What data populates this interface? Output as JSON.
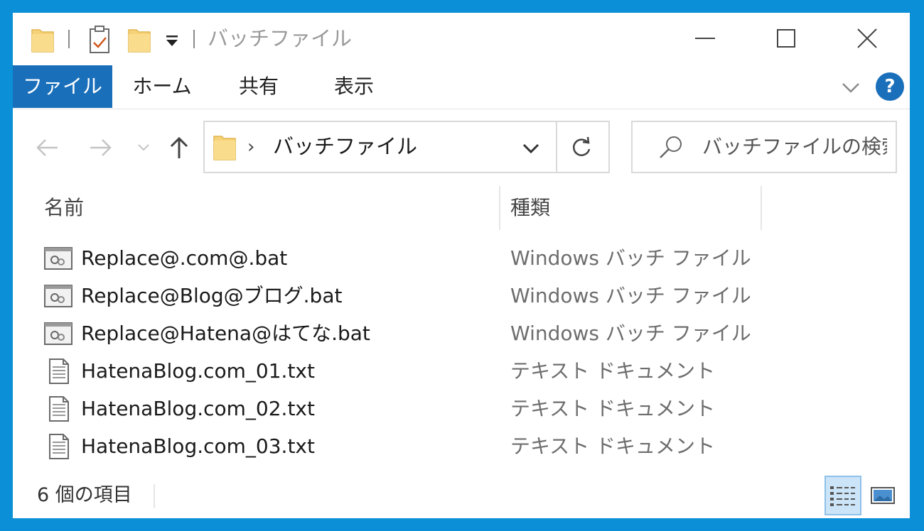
{
  "window": {
    "title": "バッチファイル"
  },
  "ribbon": {
    "tabs": [
      {
        "label": "ファイル"
      },
      {
        "label": "ホーム"
      },
      {
        "label": "共有"
      },
      {
        "label": "表示"
      }
    ],
    "help_label": "?"
  },
  "navigation": {
    "breadcrumb_separator": "›",
    "address_path": "バッチファイル",
    "search_placeholder": "バッチファイルの検索"
  },
  "columns": {
    "name": "名前",
    "type": "種類"
  },
  "files": [
    {
      "name": "Replace@.com@.bat",
      "type": "Windows バッチ ファイル",
      "icon": "batch-file-icon"
    },
    {
      "name": "Replace@Blog@ブログ.bat",
      "type": "Windows バッチ ファイル",
      "icon": "batch-file-icon"
    },
    {
      "name": "Replace@Hatena@はてな.bat",
      "type": "Windows バッチ ファイル",
      "icon": "batch-file-icon"
    },
    {
      "name": "HatenaBlog.com_01.txt",
      "type": "テキスト ドキュメント",
      "icon": "text-file-icon"
    },
    {
      "name": "HatenaBlog.com_02.txt",
      "type": "テキスト ドキュメント",
      "icon": "text-file-icon"
    },
    {
      "name": "HatenaBlog.com_03.txt",
      "type": "テキスト ドキュメント",
      "icon": "text-file-icon"
    }
  ],
  "status": {
    "item_count": "6 個の項目"
  },
  "colors": {
    "desktop": "#0b8fd6",
    "accent": "#1a6fba",
    "folder": "#f6d37a",
    "selected_view": "#cce4f7"
  }
}
